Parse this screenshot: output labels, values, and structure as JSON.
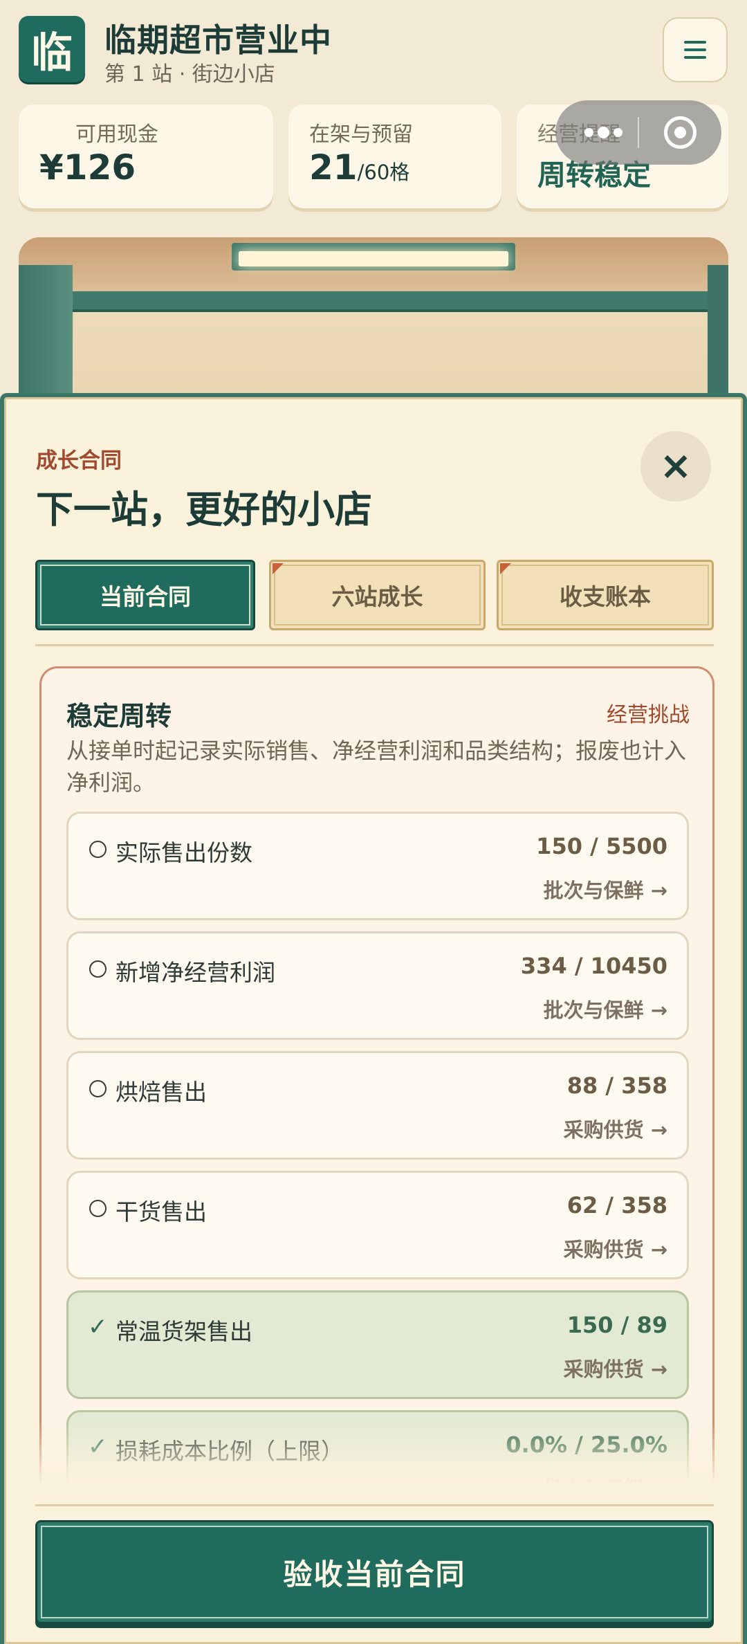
{
  "app": {
    "logo_char": "临",
    "title": "临期超市营业中",
    "subtitle": "第 1 站 · 街边小店"
  },
  "stats": [
    {
      "label": "可用现金",
      "value": "¥126",
      "unit": ""
    },
    {
      "label": "在架与预留",
      "value": "21",
      "unit": "/60格"
    },
    {
      "label": "经营提醒",
      "value": "周转稳定",
      "unit": ""
    }
  ],
  "modal": {
    "kicker": "成长合同",
    "title": "下一站，更好的小店",
    "close_icon": "×",
    "tabs": [
      {
        "label": "当前合同",
        "active": true
      },
      {
        "label": "六站成长",
        "active": false
      },
      {
        "label": "收支账本",
        "active": false
      }
    ],
    "panel": {
      "title": "稳定周转",
      "tag": "经营挑战",
      "description": "从接单时起记录实际销售、净经营利润和品类结构；报废也计入净利润。",
      "goals": [
        {
          "name": "实际售出份数",
          "progress": "150 / 5500",
          "link": "批次与保鲜",
          "done": false
        },
        {
          "name": "新增净经营利润",
          "progress": "334 / 10450",
          "link": "批次与保鲜",
          "done": false
        },
        {
          "name": "烘焙售出",
          "progress": "88 / 358",
          "link": "采购供货",
          "done": false
        },
        {
          "name": "干货售出",
          "progress": "62 / 358",
          "link": "采购供货",
          "done": false
        },
        {
          "name": "常温货架售出",
          "progress": "150 / 89",
          "link": "采购供货",
          "done": true
        },
        {
          "name": "损耗成本比例（上限）",
          "progress": "0.0% / 25.0%",
          "link": "批次与保鲜",
          "done": true
        }
      ]
    },
    "submit_label": "验收当前合同"
  },
  "colors": {
    "brand_green": "#1f6b5d",
    "accent_red": "#a0492d",
    "panel_bg": "#fbf2dc"
  }
}
